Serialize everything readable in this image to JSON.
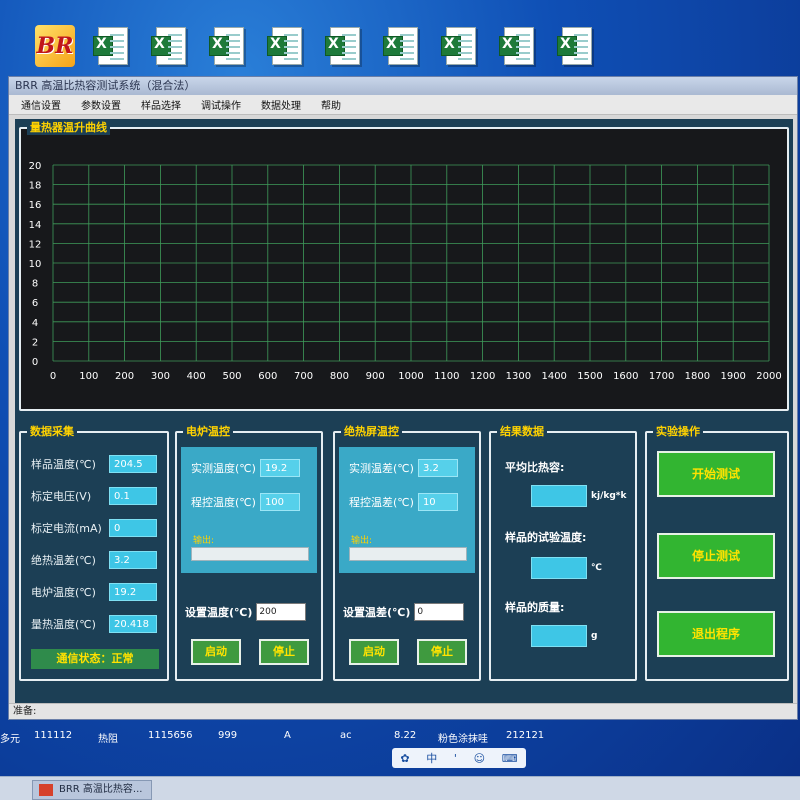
{
  "window": {
    "title": "BRR 高温比热容测试系统（混合法）"
  },
  "menu": [
    "通信设置",
    "参数设置",
    "样品选择",
    "调试操作",
    "数据处理",
    "帮助"
  ],
  "chart_panel": {
    "title": "量热器温升曲线"
  },
  "chart_data": {
    "type": "line",
    "x_ticks": [
      0,
      100,
      200,
      300,
      400,
      500,
      600,
      700,
      800,
      900,
      1000,
      1100,
      1200,
      1300,
      1400,
      1500,
      1600,
      1700,
      1800,
      1900,
      2000
    ],
    "y_ticks": [
      0,
      2,
      4,
      6,
      8,
      10,
      12,
      14,
      16,
      18,
      20
    ],
    "xlim": [
      0,
      2000
    ],
    "ylim": [
      0,
      20
    ],
    "grid": true,
    "series": []
  },
  "data_panel": {
    "title": "数据采集",
    "rows": [
      {
        "label": "样品温度(℃)",
        "value": "204.5"
      },
      {
        "label": "标定电压(V)",
        "value": "0.1"
      },
      {
        "label": "标定电流(mA)",
        "value": "0"
      },
      {
        "label": "绝热温差(℃)",
        "value": "3.2"
      },
      {
        "label": "电炉温度(℃)",
        "value": "19.2"
      },
      {
        "label": "量热温度(℃)",
        "value": "20.418"
      }
    ],
    "status": "通信状态：正常"
  },
  "furnace": {
    "title": "电炉温控",
    "measured_label": "实测温度(℃)",
    "measured_value": "19.2",
    "program_label": "程控温度(℃)",
    "program_value": "100",
    "output_label": "输出:",
    "output_level": 0,
    "set_label": "设置温度(℃)",
    "set_value": "200",
    "start": "启动",
    "stop": "停止"
  },
  "shield": {
    "title": "绝热屏温控",
    "measured_label": "实测温差(℃)",
    "measured_value": "3.2",
    "program_label": "程控温差(℃)",
    "program_value": "10",
    "output_label": "输出:",
    "output_level": 0,
    "set_label": "设置温差(℃)",
    "set_value": "0",
    "start": "启动",
    "stop": "停止"
  },
  "result": {
    "title": "结果数据",
    "avg_label": "平均比热容:",
    "avg_unit": "kj/kg*k",
    "temp_label": "样品的试验温度:",
    "temp_unit": "℃",
    "mass_label": "样品的质量:",
    "mass_unit": "g"
  },
  "ops": {
    "title": "实验操作",
    "start_test": "开始测试",
    "stop_test": "停止测试",
    "exit": "退出程序"
  },
  "statusbar": {
    "text": "准备:"
  },
  "desktop_row": [
    "多元",
    "111112",
    "热阻",
    "1115656",
    "999",
    "A",
    "ac",
    "8.22",
    "粉色涂抹哇",
    "212121"
  ],
  "ime": [
    "中",
    "'",
    "☺",
    "⌨"
  ],
  "taskbar": {
    "app": "BRR 高温比热容..."
  },
  "colors": {
    "window_bg": "#1c3f55",
    "label_accent": "#ffd200",
    "field": "#3ec6e6",
    "button": "#32b531",
    "grid": "#3f9a5a"
  }
}
